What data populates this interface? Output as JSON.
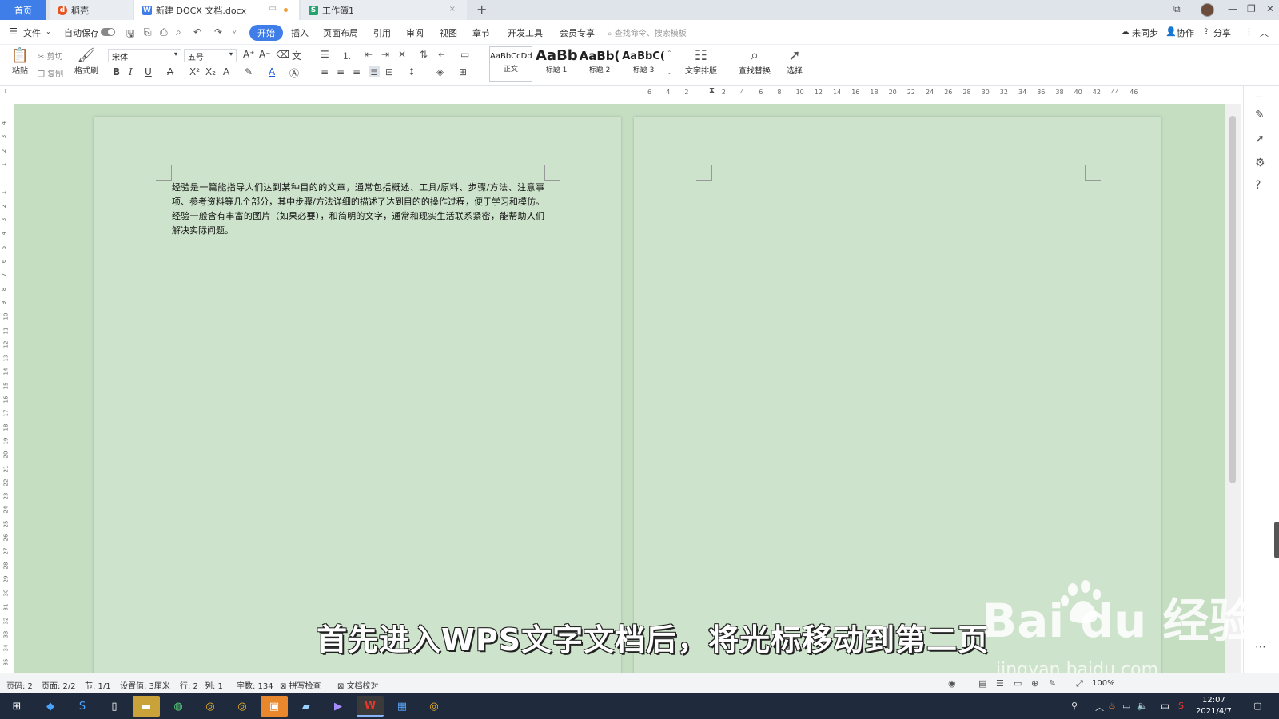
{
  "tabs": {
    "home": "首页",
    "daoke": "稻壳",
    "doc": "新建 DOCX 文档.docx",
    "sheet": "工作簿1"
  },
  "menu": {
    "file": "文件",
    "autosave": "自动保存",
    "items": [
      "开始",
      "插入",
      "页面布局",
      "引用",
      "审阅",
      "视图",
      "章节",
      "开发工具",
      "会员专享"
    ],
    "search_placeholder": "查找命令、搜索模板",
    "unsync": "未同步",
    "collab": "协作",
    "share": "分享"
  },
  "ribbon": {
    "paste": "粘贴",
    "cut": "剪切",
    "copy": "复制",
    "format_painter": "格式刷",
    "font_name": "宋体",
    "font_size": "五号",
    "styles": [
      {
        "preview": "AaBbCcDd",
        "label": "正文"
      },
      {
        "preview": "AaBb",
        "label": "标题 1"
      },
      {
        "preview": "AaBb(",
        "label": "标题 2"
      },
      {
        "preview": "AaBbC(",
        "label": "标题 3"
      }
    ],
    "text_layout": "文字排版",
    "find_replace": "查找替换",
    "select": "选择"
  },
  "ruler": {
    "h_ticks": [
      "6",
      "4",
      "2",
      "",
      "2",
      "4",
      "6",
      "8",
      "10",
      "12",
      "14",
      "16",
      "18",
      "20",
      "22",
      "24",
      "26",
      "28",
      "30",
      "32",
      "34",
      "36",
      "38",
      "40",
      "42",
      "44",
      "46"
    ],
    "v_ticks": [
      "4",
      "3",
      "2",
      "1",
      "",
      "1",
      "2",
      "3",
      "4",
      "5",
      "6",
      "7",
      "8",
      "9",
      "10",
      "11",
      "12",
      "13",
      "14",
      "15",
      "16",
      "17",
      "18",
      "19",
      "20",
      "21",
      "22",
      "23",
      "24",
      "25",
      "26",
      "27",
      "28",
      "29",
      "30",
      "31",
      "32",
      "33",
      "34",
      "35"
    ]
  },
  "document": {
    "body": "经验是一篇能指导人们达到某种目的的文章，通常包括概述、工具/原料、步骤/方法、注意事项、参考资料等几个部分，其中步骤/方法详细的描述了达到目的的操作过程，便于学习和模仿。经验一般含有丰富的图片（如果必要），和简明的文字，通常和现实生活联系紧密，能帮助人们解决实际问题。"
  },
  "overlay": {
    "subtitle": "首先进入WPS文字文档后，将光标移动到第二页",
    "watermark_main": "Bai  du 经验",
    "watermark_url": "jingyan.baidu.com"
  },
  "status": {
    "page_num": "页码: 2",
    "pages": "页面: 2/2",
    "section": "节: 1/1",
    "setting": "设置值: 3厘米",
    "row": "行: 2",
    "col": "列: 1",
    "words": "字数: 134",
    "spell": "拼写检查",
    "proof": "文档校对",
    "zoom": "100%"
  },
  "clock": {
    "time": "12:07",
    "date": "2021/4/7"
  },
  "tray": {
    "ime": "中"
  },
  "colors": {
    "accent": "#3f7ee8",
    "page_bg": "#cde3cb",
    "workspace": "#c5dec2"
  }
}
